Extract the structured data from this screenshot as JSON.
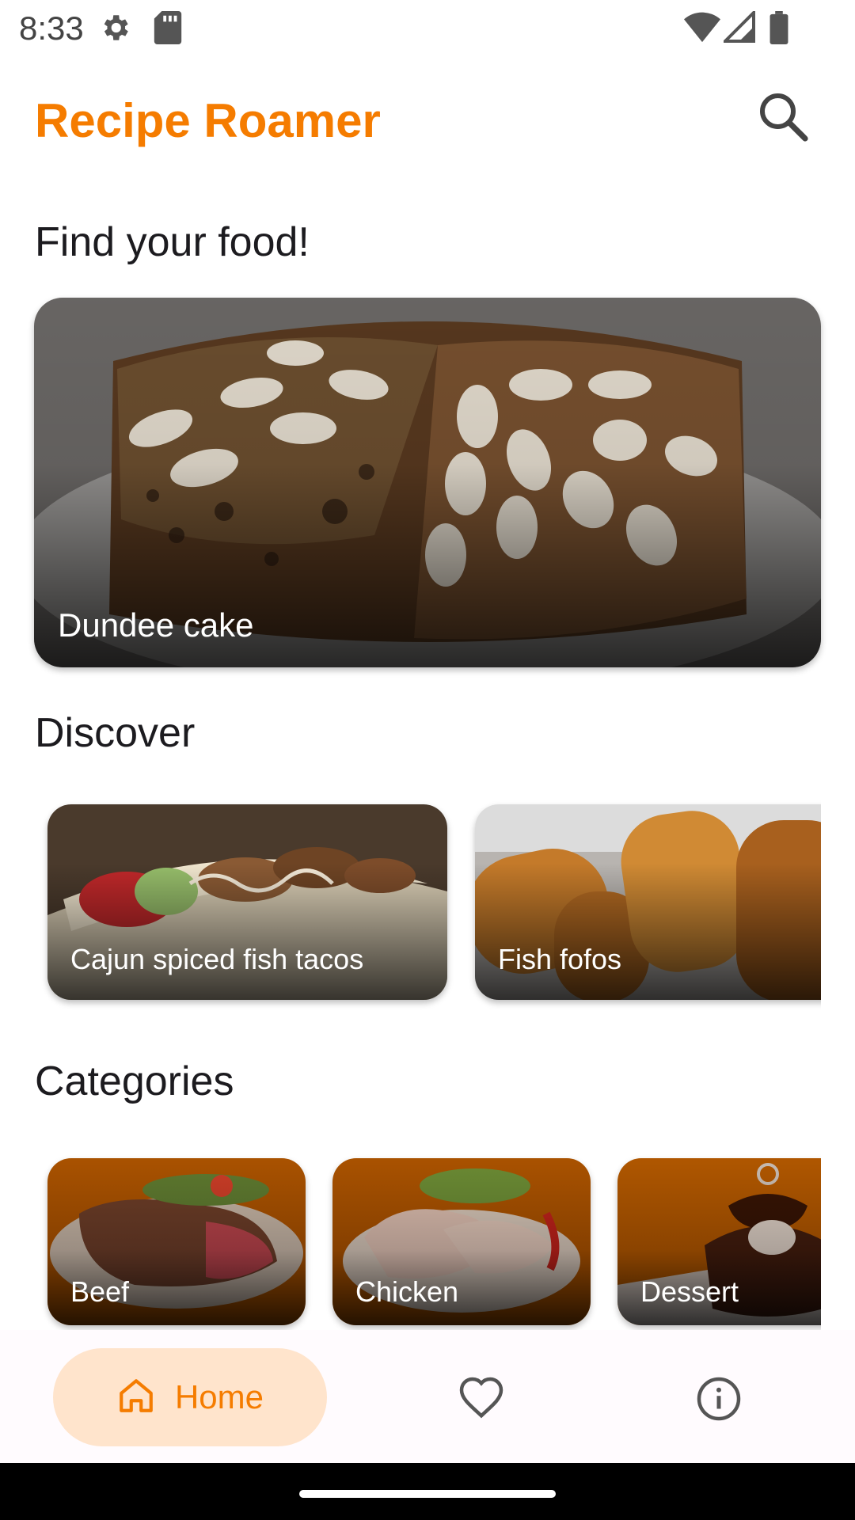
{
  "status_bar": {
    "time": "8:33",
    "icons": [
      "gear-icon",
      "sd-card-icon",
      "wifi-icon",
      "signal-icon",
      "battery-icon"
    ]
  },
  "app_bar": {
    "title": "Recipe Roamer",
    "search_icon": "search-icon"
  },
  "colors": {
    "accent": "#f57c00",
    "nav_active_bg": "#ffe4cc"
  },
  "sections": {
    "find_title": "Find your food!",
    "discover_title": "Discover",
    "categories_title": "Categories"
  },
  "featured": {
    "label": "Dundee cake"
  },
  "discover": [
    {
      "label": "Cajun spiced fish tacos"
    },
    {
      "label": "Fish fofos"
    }
  ],
  "categories": [
    {
      "label": "Beef"
    },
    {
      "label": "Chicken"
    },
    {
      "label": "Dessert"
    }
  ],
  "bottom_nav": {
    "home_label": "Home",
    "items": [
      "home-icon",
      "favorite-icon",
      "info-icon"
    ]
  }
}
